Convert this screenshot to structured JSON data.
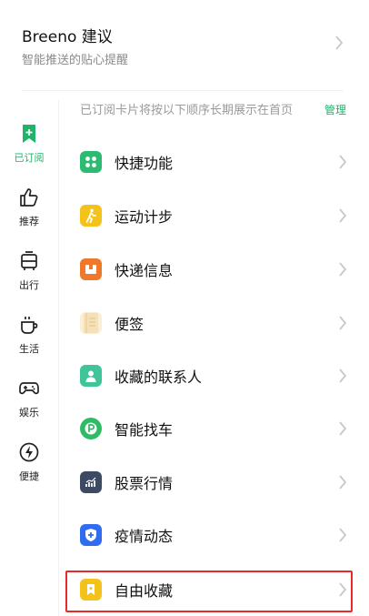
{
  "header": {
    "title": "Breeno 建议",
    "subtitle": "智能推送的贴心提醒"
  },
  "notice": {
    "text": "已订阅卡片将按以下顺序长期展示在首页",
    "action": "管理"
  },
  "sidebar": {
    "items": [
      {
        "label": "已订阅",
        "icon": "bookmark-plus-icon",
        "active": true
      },
      {
        "label": "推荐",
        "icon": "thumbs-up-icon",
        "active": false
      },
      {
        "label": "出行",
        "icon": "bus-icon",
        "active": false
      },
      {
        "label": "生活",
        "icon": "cup-icon",
        "active": false
      },
      {
        "label": "娱乐",
        "icon": "gamepad-icon",
        "active": false
      },
      {
        "label": "便捷",
        "icon": "lightning-icon",
        "active": false
      }
    ]
  },
  "list": {
    "items": [
      {
        "label": "快捷功能",
        "icon": "shortcut-grid-icon",
        "color": "#2dbb74"
      },
      {
        "label": "运动计步",
        "icon": "walking-person-icon",
        "color": "#f3c21b"
      },
      {
        "label": "快递信息",
        "icon": "package-icon",
        "color": "#f0782a"
      },
      {
        "label": "便签",
        "icon": "note-icon",
        "color": "#f5dcaa"
      },
      {
        "label": "收藏的联系人",
        "icon": "contact-icon",
        "color": "#40c59a"
      },
      {
        "label": "智能找车",
        "icon": "parking-icon",
        "color": "#2dbb66"
      },
      {
        "label": "股票行情",
        "icon": "stock-chart-icon",
        "color": "#3e4a63"
      },
      {
        "label": "疫情动态",
        "icon": "shield-plus-icon",
        "color": "#2f6cf0"
      },
      {
        "label": "自由收藏",
        "icon": "favorite-bookmark-icon",
        "color": "#f3c21b"
      }
    ]
  }
}
